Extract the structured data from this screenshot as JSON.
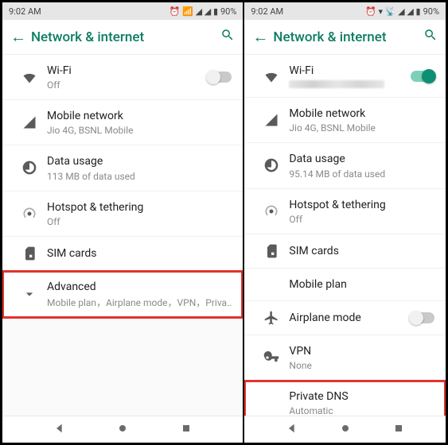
{
  "left": {
    "status": {
      "time": "9:02 AM",
      "battery": "90%"
    },
    "appbar_title": "Network & internet",
    "items": {
      "wifi": {
        "label": "Wi-Fi",
        "sub": "Off"
      },
      "mobile": {
        "label": "Mobile network",
        "sub": "Jio 4G, BSNL Mobile"
      },
      "data": {
        "label": "Data usage",
        "sub": "113 MB of data used"
      },
      "hotspot": {
        "label": "Hotspot & tethering",
        "sub": "Off"
      },
      "sim": {
        "label": "SIM cards"
      },
      "adv": {
        "label": "Advanced",
        "sub": "Mobile plan，Airplane mode，VPN，Priva.."
      }
    }
  },
  "right": {
    "status": {
      "time": "9:02 AM",
      "battery": "90%"
    },
    "appbar_title": "Network & internet",
    "items": {
      "wifi": {
        "label": "Wi-Fi"
      },
      "mobile": {
        "label": "Mobile network",
        "sub": "Jio 4G, BSNL Mobile"
      },
      "data": {
        "label": "Data usage",
        "sub": "95.14 MB of data used"
      },
      "hotspot": {
        "label": "Hotspot & tethering",
        "sub": "Off"
      },
      "sim": {
        "label": "SIM cards"
      },
      "plan": {
        "label": "Mobile plan"
      },
      "air": {
        "label": "Airplane mode"
      },
      "vpn": {
        "label": "VPN",
        "sub": "None"
      },
      "dns": {
        "label": "Private DNS",
        "sub": "Automatic"
      }
    }
  }
}
